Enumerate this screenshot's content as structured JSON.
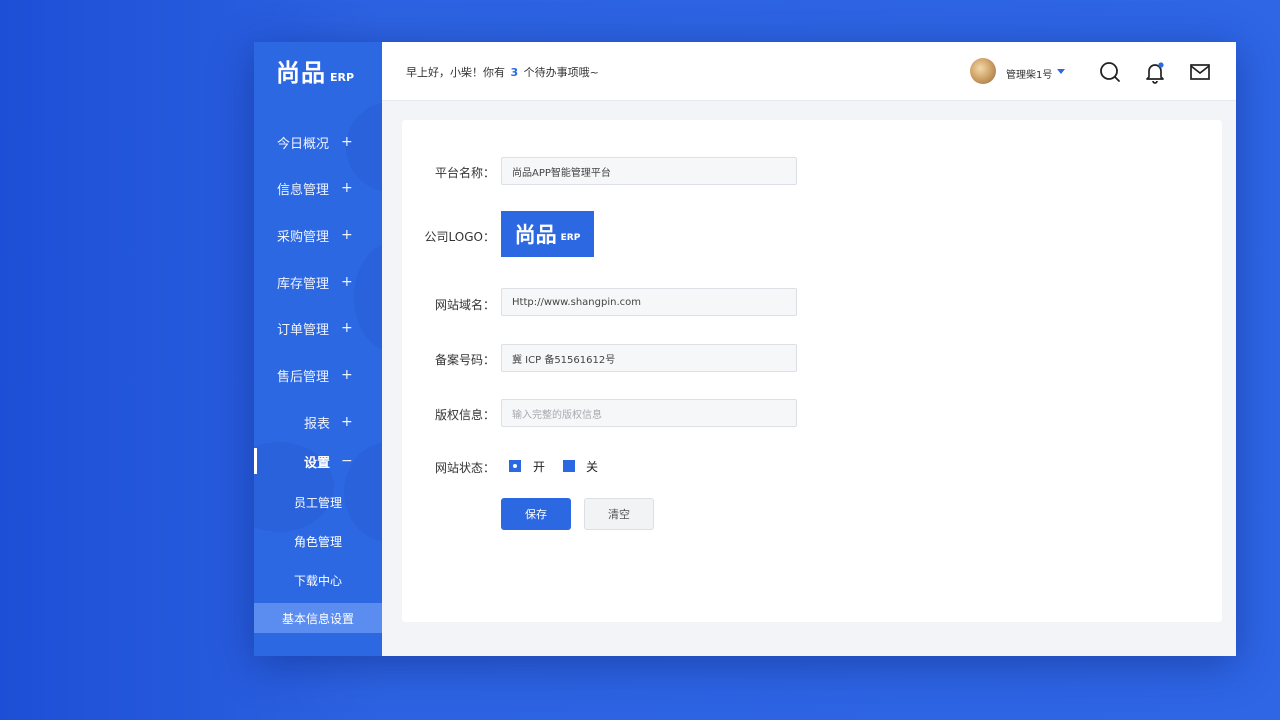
{
  "sidebar": {
    "logo_cn": "尚品",
    "logo_en": "ERP",
    "items": [
      {
        "label": "今日概况",
        "sign": "+"
      },
      {
        "label": "信息管理",
        "sign": "+"
      },
      {
        "label": "采购管理",
        "sign": "+"
      },
      {
        "label": "库存管理",
        "sign": "+"
      },
      {
        "label": "订单管理",
        "sign": "+"
      },
      {
        "label": "售后管理",
        "sign": "+"
      },
      {
        "label": "报表",
        "sign": "+"
      },
      {
        "label": "设置",
        "sign": "−"
      }
    ],
    "sub_items": [
      {
        "label": "员工管理"
      },
      {
        "label": "角色管理"
      },
      {
        "label": "下载中心"
      },
      {
        "label": "基本信息设置"
      }
    ]
  },
  "header": {
    "greeting_prefix": "早上好，小柴！你有",
    "todo_count": "3",
    "greeting_suffix": "个待办事项哦~",
    "user_name": "管理柴1号",
    "icons": [
      "search-icon",
      "bell-icon",
      "mail-icon"
    ]
  },
  "form": {
    "platform_label": "平台名称：",
    "platform_value": "尚品APP智能管理平台",
    "logo_label": "公司LOGO：",
    "logo_cn": "尚品",
    "logo_en": "ERP",
    "domain_label": "网站域名：",
    "domain_value": "Http://www.shangpin.com",
    "icp_label": "备案号码：",
    "icp_value": "冀 ICP 备51561612号",
    "copyright_label": "版权信息：",
    "copyright_placeholder": "输入完整的版权信息",
    "status_label": "网站状态：",
    "status_on": "开",
    "status_off": "关",
    "save_label": "保存",
    "clear_label": "清空"
  },
  "colors": {
    "primary": "#2d68e3",
    "background": "#2d63e2"
  }
}
